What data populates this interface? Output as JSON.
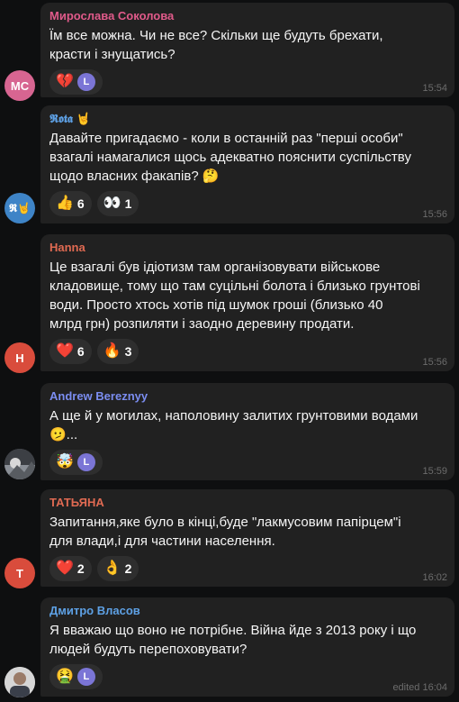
{
  "messages": [
    {
      "author": "Мирослава Соколова",
      "author_color": "#e05a8a",
      "avatar_initials": "МС",
      "avatar_color": "#d76591",
      "text": "Їм все можна. Чи не все? Скільки ще будуть брехати,\nкрасти і знущатись?",
      "reactions": [
        {
          "emoji": "💔",
          "count": "",
          "user_avatar": "L"
        }
      ],
      "time": "15:54"
    },
    {
      "author": "𝕽𝖔𝖙𝖆 🤘",
      "author_color": "#5ea1e5",
      "avatar_initials": "𝕽🤘",
      "avatar_color": "#3e84c7",
      "text": "Давайте пригадаємо - коли в останній раз \"перші особи\"\nвзагалі намагалися щось адекватно пояснити суспільству\nщодо власних факапів? 🤔",
      "reactions": [
        {
          "emoji": "👍",
          "count": "6"
        },
        {
          "emoji": "👀",
          "count": "1"
        }
      ],
      "time": "15:56"
    },
    {
      "author": "Hanna",
      "author_color": "#e06a52",
      "avatar_initials": "H",
      "avatar_color": "#d94c3c",
      "text": "Це взагалі був ідіотизм там організовувати військове\nкладовище, тому що там суцільні болота і близько грунтові\nводи. Просто хтось хотів під шумок гроші (близько 40\nмлрд грн) розпиляти і заодно деревину продати.",
      "reactions": [
        {
          "emoji": "❤️",
          "count": "6"
        },
        {
          "emoji": "🔥",
          "count": "3"
        }
      ],
      "time": "15:56"
    },
    {
      "author": "Andrew Bereznyy",
      "author_color": "#7b8df0",
      "avatar_initials": "",
      "avatar_color": "#6a7078",
      "text": "А ще й у могилах, наполовину залитих грунтовими водами\n🫤...",
      "reactions": [
        {
          "emoji": "🤯",
          "count": "",
          "user_avatar": "L"
        }
      ],
      "time": "15:59"
    },
    {
      "author": "ТАТЬЯНА",
      "author_color": "#e06a52",
      "avatar_initials": "Т",
      "avatar_color": "#d94c3c",
      "text": "Запитання,яке було в кінці,буде \"лакмусовим папірцем\"і\nдля влади,і для частини населення.",
      "reactions": [
        {
          "emoji": "❤️",
          "count": "2"
        },
        {
          "emoji": "👌",
          "count": "2"
        }
      ],
      "time": "16:02"
    },
    {
      "author": "Дмитро Власов",
      "author_color": "#5ea1e5",
      "avatar_initials": "",
      "avatar_color": "#b8b8b8",
      "text": "Я вважаю що воно не потрібне. Війна йде з 2013 року і що\nлюдей будуть перепоховувати?",
      "reactions": [
        {
          "emoji": "🤮",
          "count": "",
          "user_avatar": "L"
        }
      ],
      "time": "edited 16:04"
    }
  ]
}
